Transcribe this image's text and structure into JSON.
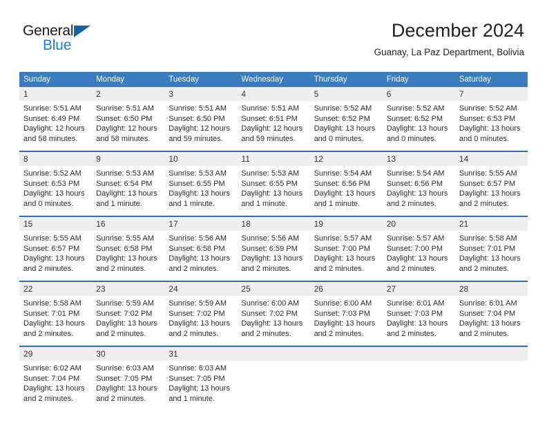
{
  "brand": {
    "name_part1": "General",
    "name_part2": "Blue",
    "accent_color": "#1b7fd4",
    "triangle_color": "#1464a5"
  },
  "header": {
    "title": "December 2024",
    "location": "Guanay, La Paz Department, Bolivia"
  },
  "calendar": {
    "header_bg": "#3a7cbe",
    "daynum_bg": "#efefef",
    "separator_color": "#2f6fae",
    "weekday_headers": [
      "Sunday",
      "Monday",
      "Tuesday",
      "Wednesday",
      "Thursday",
      "Friday",
      "Saturday"
    ],
    "weeks": [
      {
        "days": [
          {
            "num": "1",
            "sunrise": "Sunrise: 5:51 AM",
            "sunset": "Sunset: 6:49 PM",
            "daylight": "Daylight: 12 hours and 58 minutes."
          },
          {
            "num": "2",
            "sunrise": "Sunrise: 5:51 AM",
            "sunset": "Sunset: 6:50 PM",
            "daylight": "Daylight: 12 hours and 58 minutes."
          },
          {
            "num": "3",
            "sunrise": "Sunrise: 5:51 AM",
            "sunset": "Sunset: 6:50 PM",
            "daylight": "Daylight: 12 hours and 59 minutes."
          },
          {
            "num": "4",
            "sunrise": "Sunrise: 5:51 AM",
            "sunset": "Sunset: 6:51 PM",
            "daylight": "Daylight: 12 hours and 59 minutes."
          },
          {
            "num": "5",
            "sunrise": "Sunrise: 5:52 AM",
            "sunset": "Sunset: 6:52 PM",
            "daylight": "Daylight: 13 hours and 0 minutes."
          },
          {
            "num": "6",
            "sunrise": "Sunrise: 5:52 AM",
            "sunset": "Sunset: 6:52 PM",
            "daylight": "Daylight: 13 hours and 0 minutes."
          },
          {
            "num": "7",
            "sunrise": "Sunrise: 5:52 AM",
            "sunset": "Sunset: 6:53 PM",
            "daylight": "Daylight: 13 hours and 0 minutes."
          }
        ]
      },
      {
        "days": [
          {
            "num": "8",
            "sunrise": "Sunrise: 5:52 AM",
            "sunset": "Sunset: 6:53 PM",
            "daylight": "Daylight: 13 hours and 0 minutes."
          },
          {
            "num": "9",
            "sunrise": "Sunrise: 5:53 AM",
            "sunset": "Sunset: 6:54 PM",
            "daylight": "Daylight: 13 hours and 1 minute."
          },
          {
            "num": "10",
            "sunrise": "Sunrise: 5:53 AM",
            "sunset": "Sunset: 6:55 PM",
            "daylight": "Daylight: 13 hours and 1 minute."
          },
          {
            "num": "11",
            "sunrise": "Sunrise: 5:53 AM",
            "sunset": "Sunset: 6:55 PM",
            "daylight": "Daylight: 13 hours and 1 minute."
          },
          {
            "num": "12",
            "sunrise": "Sunrise: 5:54 AM",
            "sunset": "Sunset: 6:56 PM",
            "daylight": "Daylight: 13 hours and 1 minute."
          },
          {
            "num": "13",
            "sunrise": "Sunrise: 5:54 AM",
            "sunset": "Sunset: 6:56 PM",
            "daylight": "Daylight: 13 hours and 2 minutes."
          },
          {
            "num": "14",
            "sunrise": "Sunrise: 5:55 AM",
            "sunset": "Sunset: 6:57 PM",
            "daylight": "Daylight: 13 hours and 2 minutes."
          }
        ]
      },
      {
        "days": [
          {
            "num": "15",
            "sunrise": "Sunrise: 5:55 AM",
            "sunset": "Sunset: 6:57 PM",
            "daylight": "Daylight: 13 hours and 2 minutes."
          },
          {
            "num": "16",
            "sunrise": "Sunrise: 5:55 AM",
            "sunset": "Sunset: 6:58 PM",
            "daylight": "Daylight: 13 hours and 2 minutes."
          },
          {
            "num": "17",
            "sunrise": "Sunrise: 5:56 AM",
            "sunset": "Sunset: 6:58 PM",
            "daylight": "Daylight: 13 hours and 2 minutes."
          },
          {
            "num": "18",
            "sunrise": "Sunrise: 5:56 AM",
            "sunset": "Sunset: 6:59 PM",
            "daylight": "Daylight: 13 hours and 2 minutes."
          },
          {
            "num": "19",
            "sunrise": "Sunrise: 5:57 AM",
            "sunset": "Sunset: 7:00 PM",
            "daylight": "Daylight: 13 hours and 2 minutes."
          },
          {
            "num": "20",
            "sunrise": "Sunrise: 5:57 AM",
            "sunset": "Sunset: 7:00 PM",
            "daylight": "Daylight: 13 hours and 2 minutes."
          },
          {
            "num": "21",
            "sunrise": "Sunrise: 5:58 AM",
            "sunset": "Sunset: 7:01 PM",
            "daylight": "Daylight: 13 hours and 2 minutes."
          }
        ]
      },
      {
        "days": [
          {
            "num": "22",
            "sunrise": "Sunrise: 5:58 AM",
            "sunset": "Sunset: 7:01 PM",
            "daylight": "Daylight: 13 hours and 2 minutes."
          },
          {
            "num": "23",
            "sunrise": "Sunrise: 5:59 AM",
            "sunset": "Sunset: 7:02 PM",
            "daylight": "Daylight: 13 hours and 2 minutes."
          },
          {
            "num": "24",
            "sunrise": "Sunrise: 5:59 AM",
            "sunset": "Sunset: 7:02 PM",
            "daylight": "Daylight: 13 hours and 2 minutes."
          },
          {
            "num": "25",
            "sunrise": "Sunrise: 6:00 AM",
            "sunset": "Sunset: 7:02 PM",
            "daylight": "Daylight: 13 hours and 2 minutes."
          },
          {
            "num": "26",
            "sunrise": "Sunrise: 6:00 AM",
            "sunset": "Sunset: 7:03 PM",
            "daylight": "Daylight: 13 hours and 2 minutes."
          },
          {
            "num": "27",
            "sunrise": "Sunrise: 6:01 AM",
            "sunset": "Sunset: 7:03 PM",
            "daylight": "Daylight: 13 hours and 2 minutes."
          },
          {
            "num": "28",
            "sunrise": "Sunrise: 6:01 AM",
            "sunset": "Sunset: 7:04 PM",
            "daylight": "Daylight: 13 hours and 2 minutes."
          }
        ]
      },
      {
        "days": [
          {
            "num": "29",
            "sunrise": "Sunrise: 6:02 AM",
            "sunset": "Sunset: 7:04 PM",
            "daylight": "Daylight: 13 hours and 2 minutes."
          },
          {
            "num": "30",
            "sunrise": "Sunrise: 6:03 AM",
            "sunset": "Sunset: 7:05 PM",
            "daylight": "Daylight: 13 hours and 2 minutes."
          },
          {
            "num": "31",
            "sunrise": "Sunrise: 6:03 AM",
            "sunset": "Sunset: 7:05 PM",
            "daylight": "Daylight: 13 hours and 1 minute."
          },
          {
            "num": "",
            "sunrise": "",
            "sunset": "",
            "daylight": ""
          },
          {
            "num": "",
            "sunrise": "",
            "sunset": "",
            "daylight": ""
          },
          {
            "num": "",
            "sunrise": "",
            "sunset": "",
            "daylight": ""
          },
          {
            "num": "",
            "sunrise": "",
            "sunset": "",
            "daylight": ""
          }
        ]
      }
    ]
  }
}
